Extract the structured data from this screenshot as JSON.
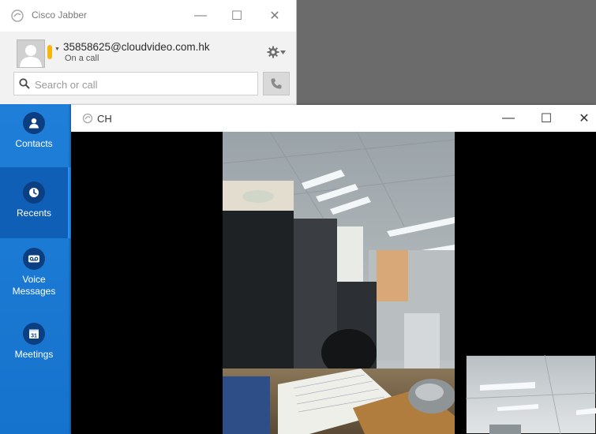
{
  "jabber": {
    "title": "Cisco Jabber",
    "controls": {
      "minimize": "—",
      "maximize": "☐",
      "close": "✕"
    },
    "profile": {
      "email": "35858625@cloudvideo.com.hk",
      "status": "On a call",
      "status_color": "#f6b60e"
    },
    "search": {
      "placeholder": "Search or call",
      "value": ""
    },
    "sidebar": {
      "accent": "#1f7fd8",
      "items": [
        {
          "label": "Contacts",
          "icon": "person-icon",
          "selected": false
        },
        {
          "label": "Recents",
          "icon": "clock-icon",
          "selected": true
        },
        {
          "label": "Voice Messages",
          "icon": "voicemail-icon",
          "selected": false
        },
        {
          "label": "Meetings",
          "icon": "calendar-icon",
          "selected": false,
          "icon_text": "31"
        }
      ]
    }
  },
  "call_window": {
    "title": "CH",
    "controls": {
      "minimize": "—",
      "maximize": "☐",
      "close": "✕"
    }
  }
}
